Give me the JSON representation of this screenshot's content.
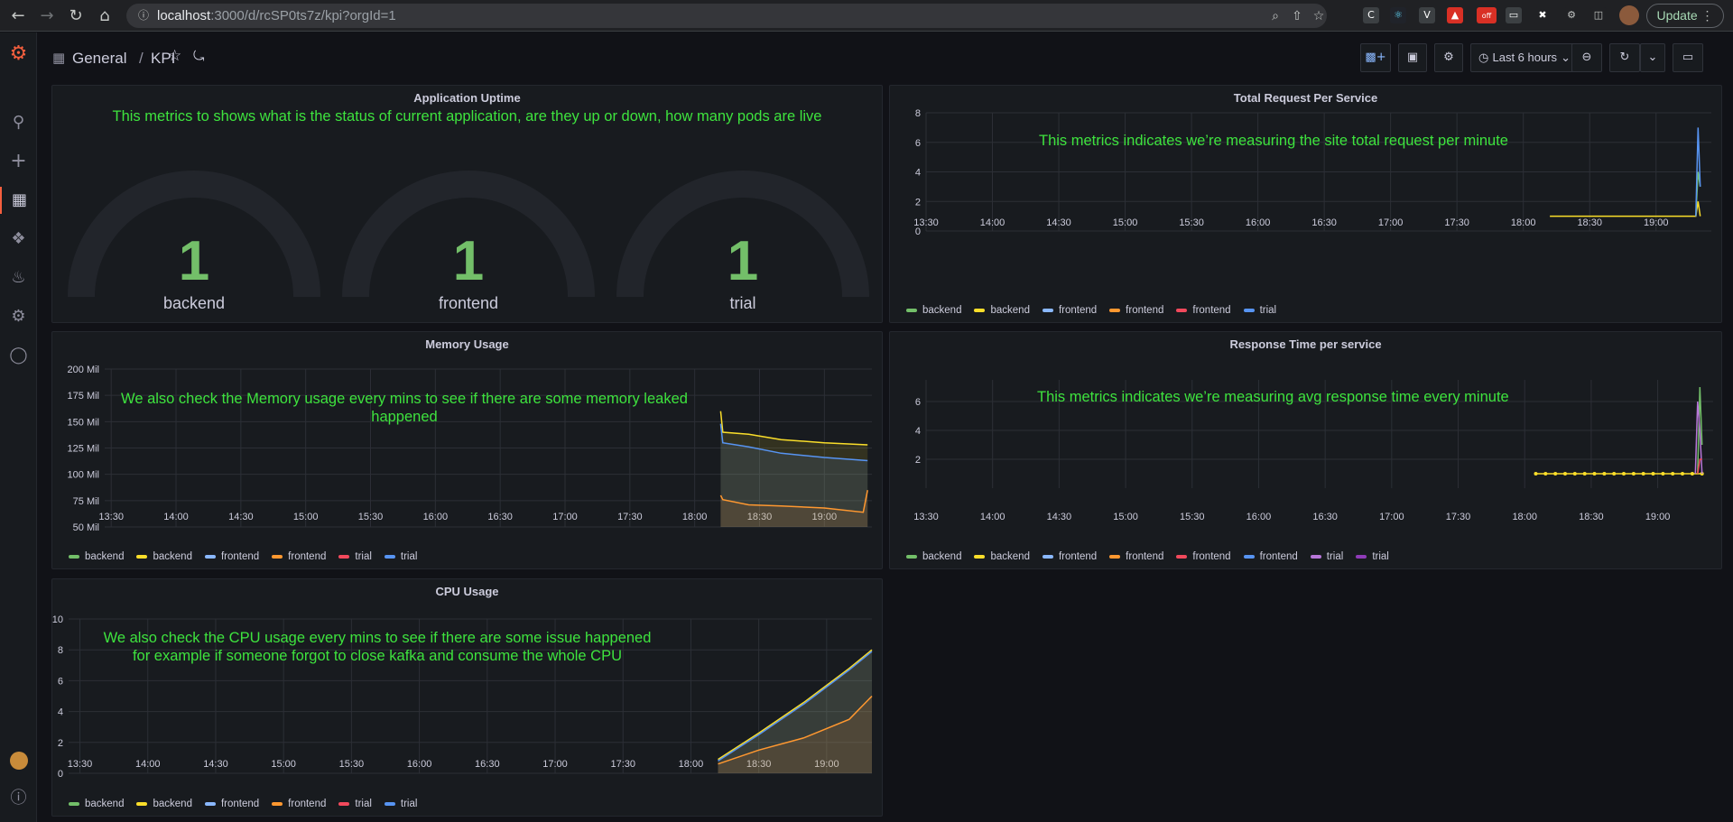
{
  "browser": {
    "url_host": "localhost",
    "url_rest": ":3000/d/rcSP0ts7z/kpi?orgId=1",
    "update_label": "Update",
    "ext_off_badge": "off"
  },
  "dashboard": {
    "folder": "General",
    "separator": "/",
    "title": "KPI",
    "time_range": "Last 6 hours"
  },
  "panels": {
    "uptime": {
      "title": "Application Uptime",
      "note": "This metrics to shows what is the status of current application, are they up or down, how many pods are live",
      "gauges": [
        {
          "value": "1",
          "label": "backend"
        },
        {
          "value": "1",
          "label": "frontend"
        },
        {
          "value": "1",
          "label": "trial"
        }
      ]
    },
    "requests": {
      "title": "Total Request Per Service",
      "note": "This metrics indicates we’re measuring the site total request per minute"
    },
    "memory": {
      "title": "Memory Usage",
      "note_line1": "We also check the Memory usage every mins to see if there are some memory leaked",
      "note_line2": "happened"
    },
    "response": {
      "title": "Response Time per service",
      "note": "This metrics indicates we’re measuring avg response time every minute"
    },
    "cpu": {
      "title": "CPU Usage",
      "note_line1": "We also check the CPU usage every mins to see if there are some issue happened",
      "note_line2": "for example if someone forgot to close kafka and consume the whole CPU"
    }
  },
  "colors": {
    "green": "#73bf69",
    "yellow": "#fade2a",
    "cyan": "#5794f2",
    "lightblue": "#8ab8ff",
    "orange": "#ff9830",
    "red": "#f2495c",
    "blue": "#5794f2",
    "purple": "#b877d9",
    "violet": "#8f3bb8",
    "note": "#3ee33e"
  },
  "chart_data": [
    {
      "id": "requests",
      "type": "line",
      "title": "Total Request Per Service",
      "x_ticks": [
        "13:30",
        "14:00",
        "14:30",
        "15:00",
        "15:30",
        "16:00",
        "16:30",
        "17:00",
        "17:30",
        "18:00",
        "18:30",
        "19:00"
      ],
      "y_ticks": [
        "0",
        "2",
        "4",
        "6",
        "8"
      ],
      "ylim": [
        0,
        8
      ],
      "legend": [
        "backend",
        "backend",
        "frontend",
        "frontend",
        "frontend",
        "trial"
      ],
      "legend_colors": [
        "#73bf69",
        "#fade2a",
        "#8ab8ff",
        "#ff9830",
        "#f2495c",
        "#5794f2"
      ],
      "series": [
        {
          "name": "backend",
          "color": "#fade2a",
          "points": [
            [
              "18:12",
              1
            ],
            [
              "19:18",
              1
            ],
            [
              "19:19",
              2
            ],
            [
              "19:20",
              1
            ]
          ]
        },
        {
          "name": "backend",
          "color": "#73bf69",
          "points": [
            [
              "19:18",
              1
            ],
            [
              "19:19",
              4
            ],
            [
              "19:20",
              3
            ]
          ]
        },
        {
          "name": "trial",
          "color": "#5794f2",
          "points": [
            [
              "19:18",
              1
            ],
            [
              "19:19",
              7
            ],
            [
              "19:20",
              3
            ]
          ]
        }
      ]
    },
    {
      "id": "memory",
      "type": "area",
      "title": "Memory Usage",
      "x_ticks": [
        "13:30",
        "14:00",
        "14:30",
        "15:00",
        "15:30",
        "16:00",
        "16:30",
        "17:00",
        "17:30",
        "18:00",
        "18:30",
        "19:00"
      ],
      "y_ticks": [
        "50 Mil",
        "75 Mil",
        "100 Mil",
        "125 Mil",
        "150 Mil",
        "175 Mil",
        "200 Mil"
      ],
      "ylim": [
        50,
        200
      ],
      "legend": [
        "backend",
        "backend",
        "frontend",
        "frontend",
        "trial",
        "trial"
      ],
      "legend_colors": [
        "#73bf69",
        "#fade2a",
        "#8ab8ff",
        "#ff9830",
        "#f2495c",
        "#5794f2"
      ],
      "series": [
        {
          "name": "backend",
          "color": "#fade2a",
          "points": [
            [
              "18:12",
              160
            ],
            [
              "18:13",
              140
            ],
            [
              "18:25",
              138
            ],
            [
              "18:40",
              133
            ],
            [
              "19:00",
              130
            ],
            [
              "19:20",
              128
            ]
          ]
        },
        {
          "name": "trial",
          "color": "#5794f2",
          "points": [
            [
              "18:12",
              148
            ],
            [
              "18:13",
              130
            ],
            [
              "18:25",
              126
            ],
            [
              "18:40",
              120
            ],
            [
              "19:00",
              116
            ],
            [
              "19:20",
              113
            ]
          ]
        },
        {
          "name": "frontend",
          "color": "#ff9830",
          "points": [
            [
              "18:12",
              80
            ],
            [
              "18:13",
              76
            ],
            [
              "18:25",
              71
            ],
            [
              "18:40",
              70
            ],
            [
              "19:00",
              68
            ],
            [
              "19:18",
              64
            ],
            [
              "19:20",
              85
            ]
          ]
        }
      ]
    },
    {
      "id": "response",
      "type": "line",
      "title": "Response Time per service",
      "x_ticks": [
        "13:30",
        "14:00",
        "14:30",
        "15:00",
        "15:30",
        "16:00",
        "16:30",
        "17:00",
        "17:30",
        "18:00",
        "18:30",
        "19:00"
      ],
      "y_ticks": [
        "2",
        "4",
        "6"
      ],
      "ylim": [
        0,
        7.5
      ],
      "legend": [
        "backend",
        "backend",
        "frontend",
        "frontend",
        "frontend",
        "frontend",
        "trial",
        "trial"
      ],
      "legend_colors": [
        "#73bf69",
        "#fade2a",
        "#8ab8ff",
        "#ff9830",
        "#f2495c",
        "#5794f2",
        "#b877d9",
        "#8f3bb8"
      ],
      "series": [
        {
          "name": "backend",
          "color": "#fade2a",
          "points": [
            [
              "18:05",
              1
            ],
            [
              "19:20",
              1
            ]
          ]
        },
        {
          "name": "backend",
          "color": "#73bf69",
          "points": [
            [
              "19:18",
              1
            ],
            [
              "19:19",
              7
            ],
            [
              "19:20",
              3
            ]
          ]
        },
        {
          "name": "trial",
          "color": "#b877d9",
          "points": [
            [
              "19:17",
              1
            ],
            [
              "19:18",
              6
            ],
            [
              "19:19",
              4
            ],
            [
              "19:20",
              1
            ]
          ]
        },
        {
          "name": "frontend",
          "color": "#f2495c",
          "points": [
            [
              "19:18",
              1
            ],
            [
              "19:19",
              2
            ],
            [
              "19:20",
              2
            ]
          ]
        }
      ]
    },
    {
      "id": "cpu",
      "type": "area",
      "title": "CPU Usage",
      "x_ticks": [
        "13:30",
        "14:00",
        "14:30",
        "15:00",
        "15:30",
        "16:00",
        "16:30",
        "17:00",
        "17:30",
        "18:00",
        "18:30",
        "19:00"
      ],
      "y_ticks": [
        "0",
        "2",
        "4",
        "6",
        "8",
        "10"
      ],
      "ylim": [
        0,
        10
      ],
      "legend": [
        "backend",
        "backend",
        "frontend",
        "frontend",
        "trial",
        "trial"
      ],
      "legend_colors": [
        "#73bf69",
        "#fade2a",
        "#8ab8ff",
        "#ff9830",
        "#f2495c",
        "#5794f2"
      ],
      "series": [
        {
          "name": "backend",
          "color": "#fade2a",
          "points": [
            [
              "18:12",
              0.9
            ],
            [
              "18:30",
              2.6
            ],
            [
              "18:50",
              4.6
            ],
            [
              "19:10",
              6.8
            ],
            [
              "19:20",
              8
            ]
          ]
        },
        {
          "name": "trial",
          "color": "#5794f2",
          "points": [
            [
              "18:12",
              0.8
            ],
            [
              "18:30",
              2.5
            ],
            [
              "18:50",
              4.5
            ],
            [
              "19:10",
              6.7
            ],
            [
              "19:20",
              7.9
            ]
          ]
        },
        {
          "name": "frontend",
          "color": "#ff9830",
          "points": [
            [
              "18:12",
              0.6
            ],
            [
              "18:30",
              1.5
            ],
            [
              "18:50",
              2.3
            ],
            [
              "19:10",
              3.5
            ],
            [
              "19:20",
              5
            ]
          ]
        }
      ]
    }
  ]
}
